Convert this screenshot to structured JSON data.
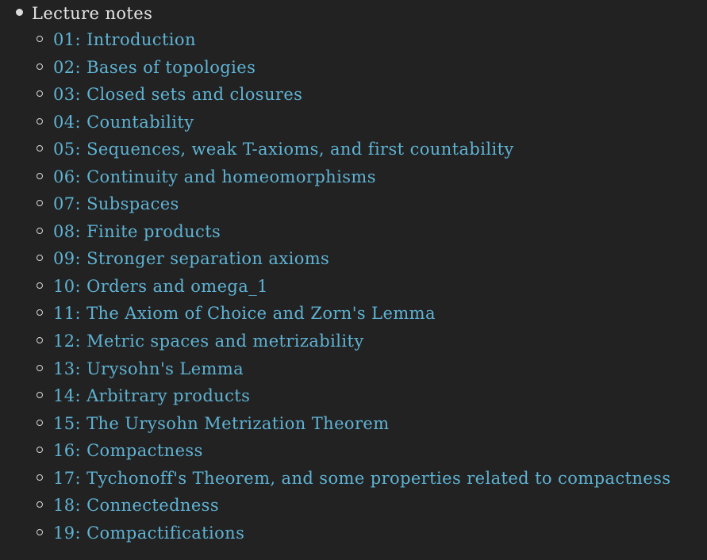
{
  "section": {
    "label": "Lecture notes",
    "colors": {
      "background": "#222222",
      "heading_text": "#e4e4e4",
      "link": "#5fb3d4",
      "bullet": "#d8d8d8"
    },
    "items": [
      {
        "label": "01: Introduction"
      },
      {
        "label": "02: Bases of topologies"
      },
      {
        "label": "03: Closed sets and closures"
      },
      {
        "label": "04: Countability"
      },
      {
        "label": "05: Sequences, weak T-axioms, and first countability"
      },
      {
        "label": "06: Continuity and homeomorphisms"
      },
      {
        "label": "07: Subspaces"
      },
      {
        "label": "08: Finite products"
      },
      {
        "label": "09: Stronger separation axioms"
      },
      {
        "label": "10: Orders and omega_1"
      },
      {
        "label": "11: The Axiom of Choice and Zorn's Lemma"
      },
      {
        "label": "12: Metric spaces and metrizability"
      },
      {
        "label": "13: Urysohn's Lemma"
      },
      {
        "label": "14: Arbitrary products"
      },
      {
        "label": "15: The Urysohn Metrization Theorem"
      },
      {
        "label": "16: Compactness"
      },
      {
        "label": "17: Tychonoff's Theorem, and some properties related to compactness"
      },
      {
        "label": "18: Connectedness"
      },
      {
        "label": "19: Compactifications"
      }
    ]
  }
}
